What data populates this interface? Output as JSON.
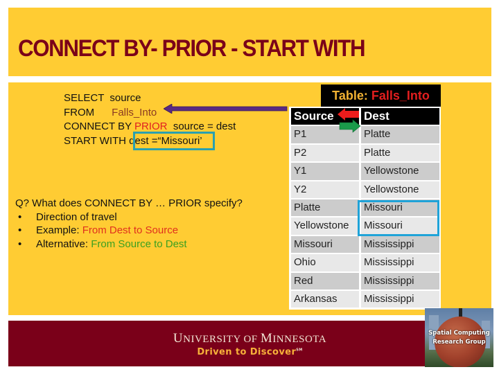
{
  "slide": {
    "title": "CONNECT BY- PRIOR - START WITH"
  },
  "sql": {
    "line1_kw": "SELECT  ",
    "line1_val": "source",
    "line2_kw": "FROM      ",
    "line2_val": "Falls_Into",
    "line3_kw": "CONNECT BY ",
    "line3_prior": "PRIOR",
    "line3_rest": "  source = dest",
    "line4_kw": "START WITH ",
    "line4_val": "dest =“Missouri’"
  },
  "question": {
    "q": "Q? What does CONNECT BY …  PRIOR specify?",
    "bullets": [
      {
        "dot": "•",
        "label": "Direction of travel",
        "colored": ""
      },
      {
        "dot": "•",
        "label": "Example: ",
        "colored": "From Dest to Source"
      },
      {
        "dot": "•",
        "label": "Alternative: ",
        "colored": "From Source to Dest"
      }
    ]
  },
  "table": {
    "title_prefix": "Table: ",
    "title_name": "Falls_Into",
    "headers": [
      "Source",
      "Dest"
    ],
    "rows": [
      [
        "P1",
        "Platte"
      ],
      [
        "P2",
        "Platte"
      ],
      [
        "Y1",
        "Yellowstone"
      ],
      [
        "Y2",
        "Yellowstone"
      ],
      [
        "Platte",
        "Missouri"
      ],
      [
        "Yellowstone",
        "Missouri"
      ],
      [
        "Missouri",
        "Mississippi"
      ],
      [
        "Ohio",
        "Mississippi"
      ],
      [
        "Red",
        "Mississippi"
      ],
      [
        "Arkansas",
        "Mississippi"
      ]
    ]
  },
  "footer": {
    "university_u": "U",
    "university_niversity": "NIVERSITY OF ",
    "university_m": "M",
    "university_innesota": "INNESOTA",
    "tagline": "Driven to Discover",
    "tagline_mark": "SM",
    "logo_line1": "Spatial Computing",
    "logo_line2": "Research Group"
  },
  "colors": {
    "gold": "#ffcc33",
    "maroon": "#7a0019",
    "highlight_red": "#e02020",
    "highlight_green": "#3aa020",
    "box_blue": "#1fa3d8",
    "arrow_purple": "#5a2a82"
  }
}
